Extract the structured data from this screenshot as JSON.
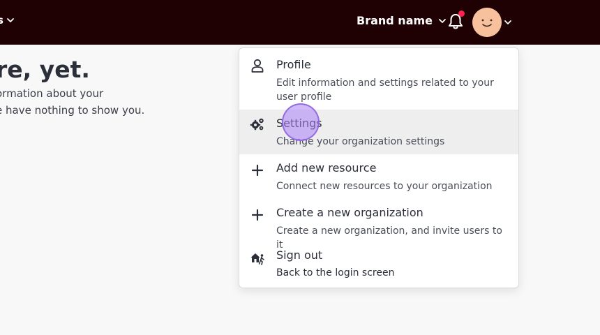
{
  "header": {
    "nav_left_label": "s",
    "brand_label": "Brand name",
    "notification_badge_color": "#ff2450",
    "header_color": "#1f0003"
  },
  "empty_state": {
    "title": "re, yet.",
    "line1": "ormation about your",
    "line2": "e have nothing to show you."
  },
  "menu": {
    "items": [
      {
        "icon": "user-icon",
        "title": "Profile",
        "description": "Edit information and settings related to your user profile"
      },
      {
        "icon": "gears-icon",
        "title": "Settings",
        "description": "Change your organization settings"
      },
      {
        "icon": "plus-icon",
        "title": "Add new resource",
        "description": "Connect new resources to your organization"
      },
      {
        "icon": "plus-icon",
        "title": "Create a new organization",
        "description": "Create a new organization, and invite users to it"
      },
      {
        "icon": "sign-out-icon",
        "title": "Sign out",
        "description": "Back to the login screen"
      }
    ]
  }
}
